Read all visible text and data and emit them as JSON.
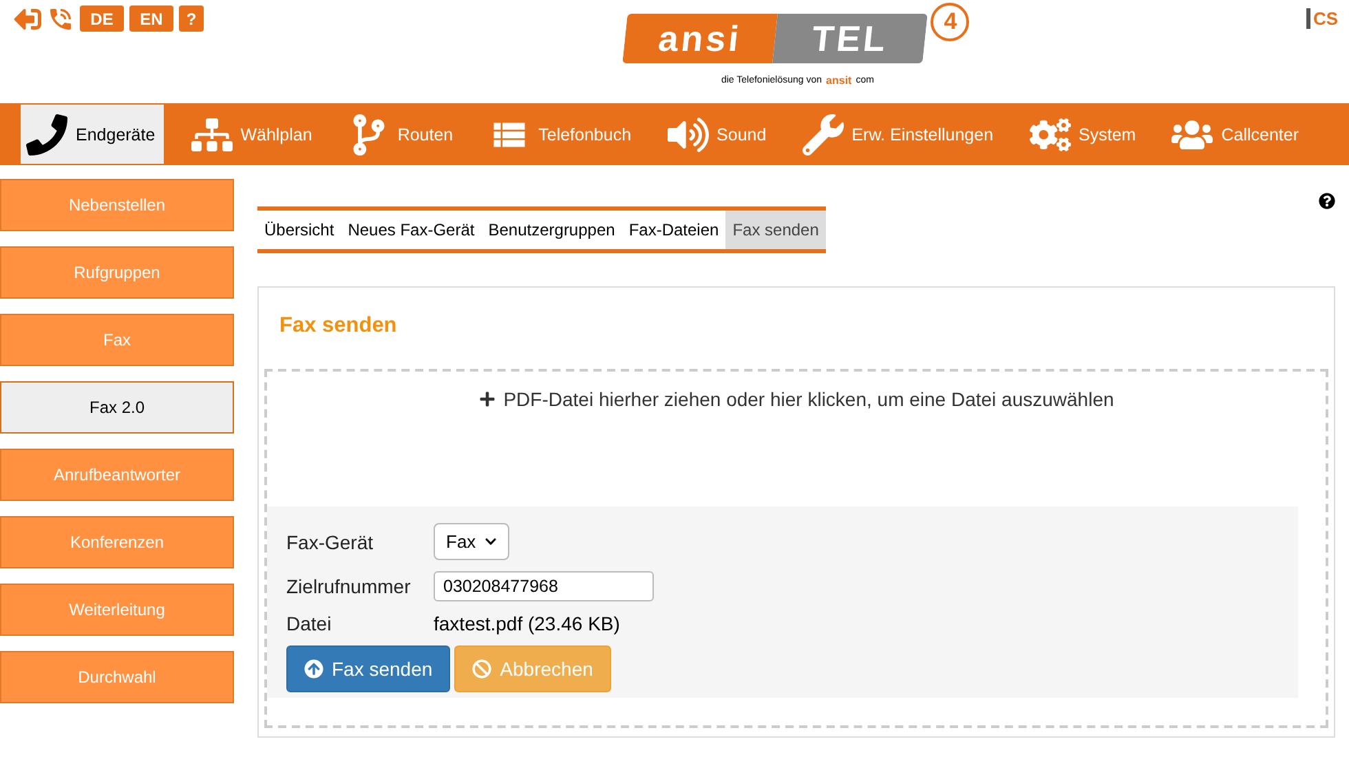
{
  "top_icons": [
    {
      "kind": "exit"
    },
    {
      "kind": "hangup"
    },
    {
      "kind": "lang",
      "label": "DE"
    },
    {
      "kind": "lang",
      "label": "EN"
    },
    {
      "kind": "help",
      "label": "?"
    }
  ],
  "logo": {
    "left": "ansi",
    "right": "TEL",
    "version": "4",
    "tagline": "die Telefonielösung von",
    "brand": "ansit",
    "brand_suffix": "com"
  },
  "corner_logo": "CS",
  "nav": [
    {
      "kind": "phone",
      "label": "Endgeräte",
      "selected": true
    },
    {
      "kind": "tree",
      "label": "Wählplan",
      "selected": false
    },
    {
      "kind": "fork",
      "label": "Routen",
      "selected": false
    },
    {
      "kind": "book",
      "label": "Telefonbuch",
      "selected": false
    },
    {
      "kind": "sound",
      "label": "Sound",
      "selected": false
    },
    {
      "kind": "wrench",
      "label": "Erw. Einstellungen",
      "selected": false
    },
    {
      "kind": "gears",
      "label": "System",
      "selected": false
    },
    {
      "kind": "people",
      "label": "Callcenter",
      "selected": false
    }
  ],
  "sidebar": [
    {
      "label": "Nebenstellen",
      "selected": false
    },
    {
      "label": "Rufgruppen",
      "selected": false
    },
    {
      "label": "Fax",
      "selected": false
    },
    {
      "label": "Fax 2.0",
      "selected": true
    },
    {
      "label": "Anrufbeantworter",
      "selected": false
    },
    {
      "label": "Konferenzen",
      "selected": false
    },
    {
      "label": "Weiterleitung",
      "selected": false
    },
    {
      "label": "Durchwahl",
      "selected": false
    }
  ],
  "tabs": [
    {
      "label": "Übersicht",
      "selected": false
    },
    {
      "label": "Neues Fax-Gerät",
      "selected": false
    },
    {
      "label": "Benutzergruppen",
      "selected": false
    },
    {
      "label": "Fax-Dateien",
      "selected": false
    },
    {
      "label": "Fax senden",
      "selected": true
    }
  ],
  "panel": {
    "title": "Fax senden",
    "dropzone": "PDF-Datei hierher ziehen oder hier klicken, um eine Datei auszuwählen",
    "fields": [
      {
        "kind": "select",
        "label": "Fax-Gerät",
        "value": "Fax"
      },
      {
        "kind": "input",
        "label": "Zielrufnummer",
        "value": "030208477968"
      },
      {
        "kind": "text",
        "label": "Datei",
        "value": "faxtest.pdf (23.46 KB)"
      }
    ],
    "buttons": [
      {
        "kind": "primary",
        "label": "Fax senden"
      },
      {
        "kind": "warning",
        "label": "Abbrechen"
      }
    ]
  }
}
